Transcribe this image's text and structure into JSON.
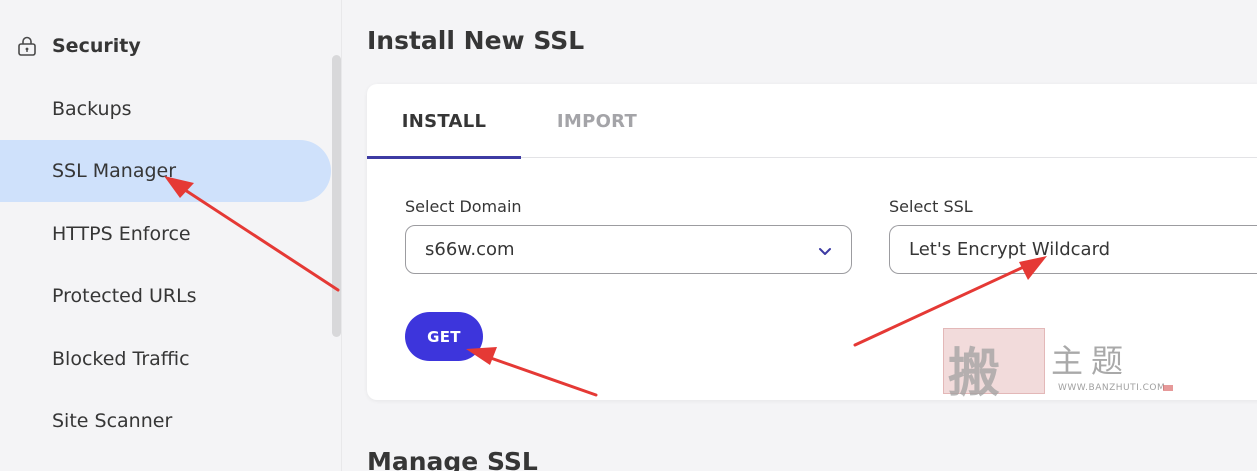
{
  "sidebar": {
    "section": {
      "label": "Security",
      "icon": "lock-icon"
    },
    "items": [
      {
        "label": "Backups"
      },
      {
        "label": "SSL Manager",
        "active": true
      },
      {
        "label": "HTTPS Enforce"
      },
      {
        "label": "Protected URLs"
      },
      {
        "label": "Blocked Traffic"
      },
      {
        "label": "Site Scanner"
      }
    ]
  },
  "main": {
    "title": "Install New SSL",
    "tabs": [
      {
        "label": "INSTALL",
        "active": true
      },
      {
        "label": "IMPORT",
        "active": false
      }
    ],
    "domain_field": {
      "label": "Select Domain",
      "value": "s66w.com"
    },
    "ssl_field": {
      "label": "Select SSL",
      "value": "Let's Encrypt Wildcard"
    },
    "get_button": "GET",
    "next_section": "Manage SSL"
  },
  "watermark": {
    "big_char": "搬",
    "chinese": "主题",
    "url": "WWW.BANZHUTI.COM"
  },
  "colors": {
    "active_bg": "#cfe1fb",
    "accent": "#3d3ba3",
    "button": "#3d35dc",
    "arrow": "#e53935"
  }
}
